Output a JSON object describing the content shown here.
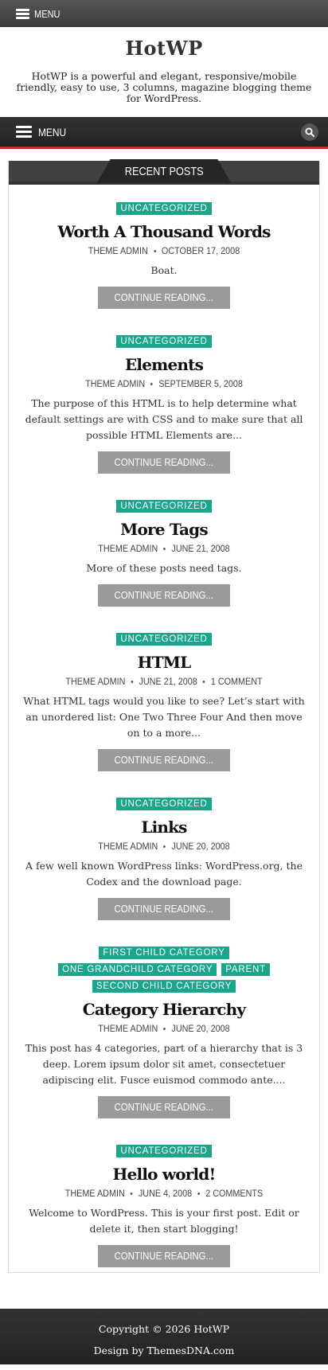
{
  "topbar": {
    "menu_label": "MENU"
  },
  "header": {
    "title": "HotWP",
    "description": "HotWP is a powerful and elegant, responsive/mobile friendly, easy to use, 3 columns, magazine blogging theme for WordPress."
  },
  "nav": {
    "menu_label": "MENU",
    "search_icon": "search-icon"
  },
  "recent": {
    "heading": "RECENT POSTS",
    "more_label": "CONTINUE READING...",
    "posts": [
      {
        "categories": [
          "UNCATEGORIZED"
        ],
        "title": "Worth A Thousand Words",
        "author": "THEME ADMIN",
        "date": "OCTOBER 17, 2008",
        "comments": "",
        "excerpt": "Boat."
      },
      {
        "categories": [
          "UNCATEGORIZED"
        ],
        "title": "Elements",
        "author": "THEME ADMIN",
        "date": "SEPTEMBER 5, 2008",
        "comments": "",
        "excerpt": "The purpose of this HTML is to help determine what default settings are with CSS and to make sure that all possible HTML Elements are..."
      },
      {
        "categories": [
          "UNCATEGORIZED"
        ],
        "title": "More Tags",
        "author": "THEME ADMIN",
        "date": "JUNE 21, 2008",
        "comments": "",
        "excerpt": "More of these posts need tags."
      },
      {
        "categories": [
          "UNCATEGORIZED"
        ],
        "title": "HTML",
        "author": "THEME ADMIN",
        "date": "JUNE 21, 2008",
        "comments": "1 COMMENT",
        "excerpt": "What HTML tags would you like to see? Let’s start with an unordered list: One Two Three Four And then move on to a more..."
      },
      {
        "categories": [
          "UNCATEGORIZED"
        ],
        "title": "Links",
        "author": "THEME ADMIN",
        "date": "JUNE 20, 2008",
        "comments": "",
        "excerpt": "A few well known WordPress links: WordPress.org, the Codex and the download page."
      },
      {
        "categories": [
          "FIRST CHILD CATEGORY",
          "ONE GRANDCHILD CATEGORY",
          "PARENT",
          "SECOND CHILD CATEGORY"
        ],
        "title": "Category Hierarchy",
        "author": "THEME ADMIN",
        "date": "JUNE 20, 2008",
        "comments": "",
        "excerpt": "This post has 4 categories, part of a hierarchy that is 3 deep. Lorem ipsum dolor sit amet, consectetuer adipiscing elit. Fusce euismod commodo ante...."
      },
      {
        "categories": [
          "UNCATEGORIZED"
        ],
        "title": "Hello world!",
        "author": "THEME ADMIN",
        "date": "JUNE 4, 2008",
        "comments": "2 COMMENTS",
        "excerpt": "Welcome to WordPress. This is your first post. Edit or delete it, then start blogging!"
      }
    ]
  },
  "footer": {
    "copyright": "Copyright © 2026 HotWP",
    "credit": "Design by ThemesDNA.com"
  },
  "colors": {
    "category_badge": "#1ba68c",
    "nav_accent": "#c0262c",
    "button": "#9a9a9a"
  }
}
